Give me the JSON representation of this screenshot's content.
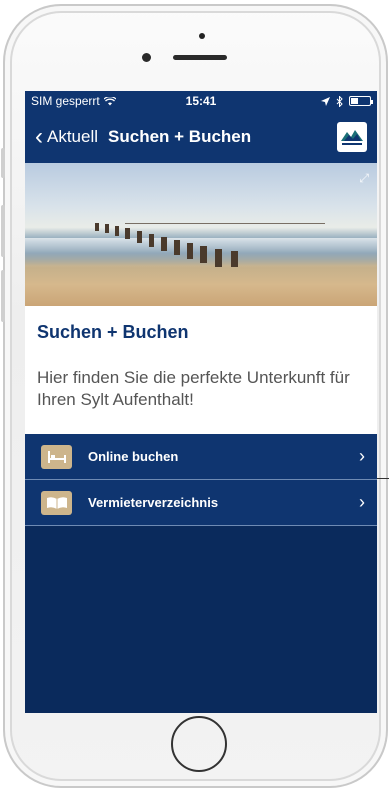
{
  "status_bar": {
    "carrier": "SIM gesperrt",
    "time": "15:41",
    "battery_level": 0.4
  },
  "nav": {
    "back_label": "Aktuell",
    "title": "Suchen + Buchen",
    "logo_icon": "sylt-logo-icon"
  },
  "hero": {
    "expand_icon": "expand-icon"
  },
  "content": {
    "heading": "Suchen + Buchen",
    "text": "Hier finden Sie die perfekte Unterkunft für Ihren Sylt Aufenthalt!"
  },
  "menu": {
    "items": [
      {
        "label": "Online buchen",
        "icon": "bed-icon"
      },
      {
        "label": "Vermieterverzeichnis",
        "icon": "book-icon"
      }
    ]
  },
  "colors": {
    "brand_blue": "#0f3570",
    "icon_tan": "#cdb58c"
  }
}
